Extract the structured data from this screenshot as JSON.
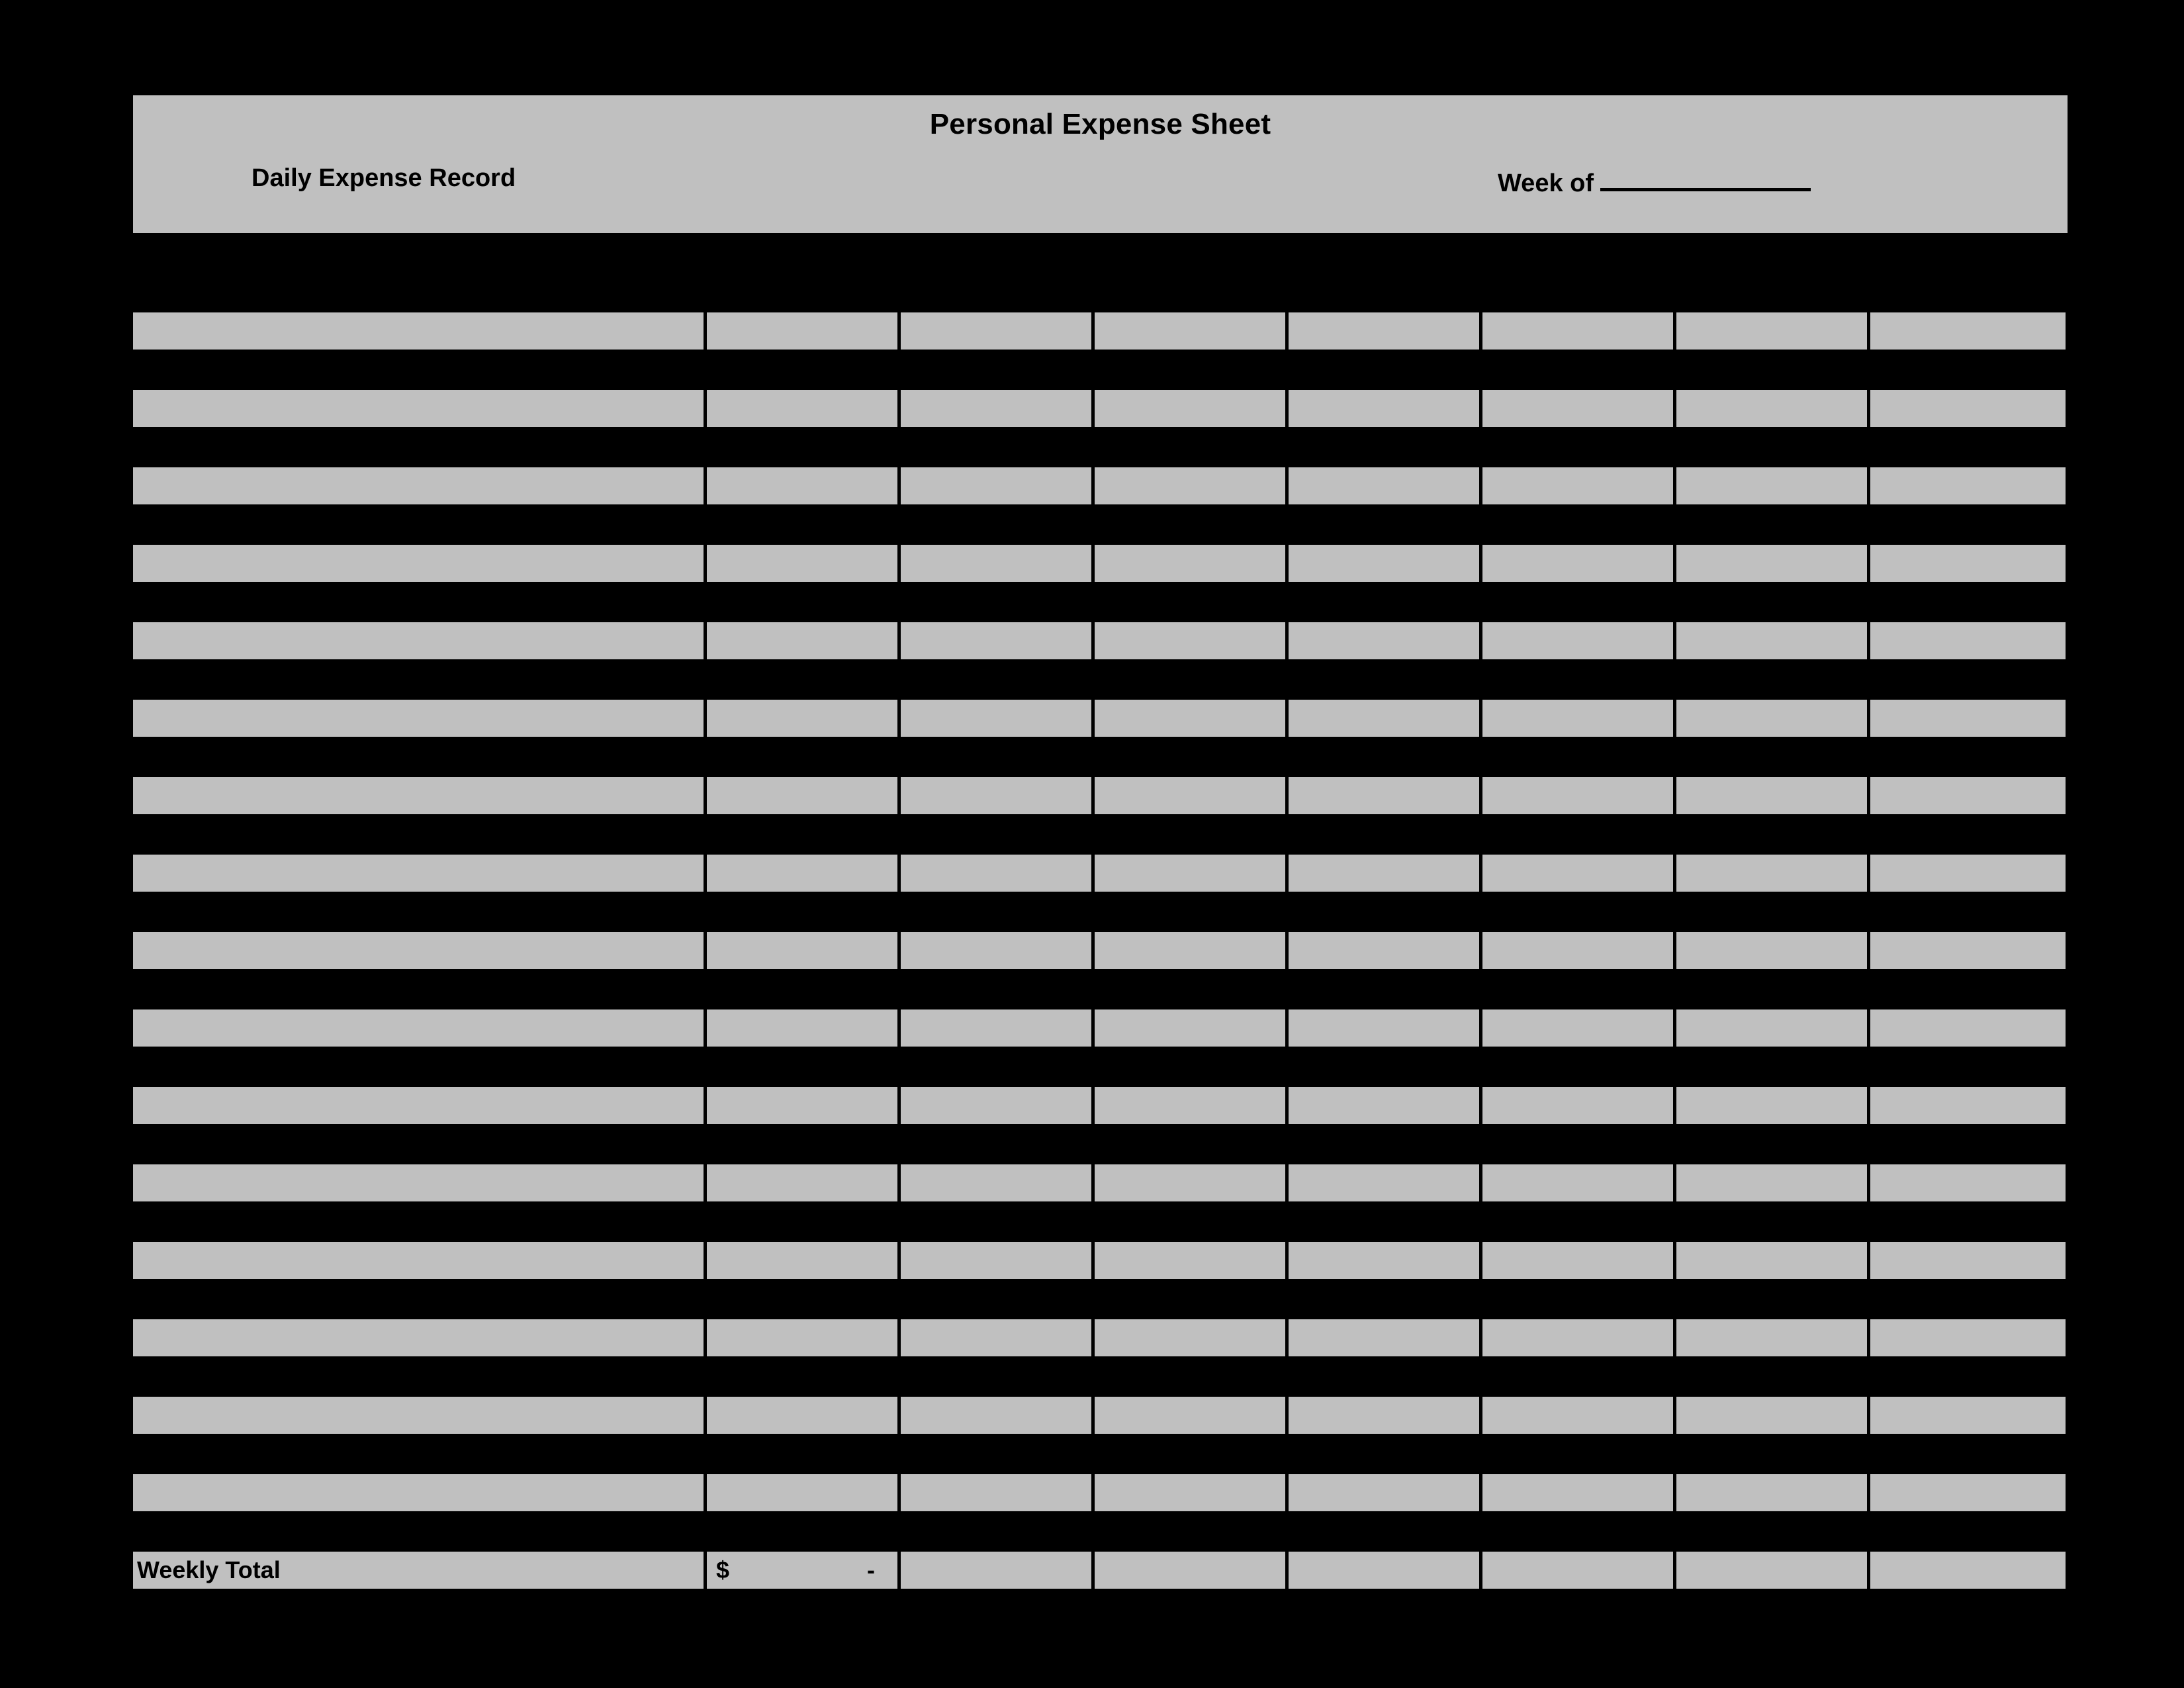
{
  "document": {
    "title": "Personal Expense Sheet",
    "subtitle": "Daily Expense Record",
    "week_of_label": "Week of",
    "week_of_value": "",
    "paper_color": "#c0c0c0",
    "ink_color": "#000000",
    "background_color": "#000000"
  },
  "table": {
    "column_count": 8,
    "entry_row_count": 16,
    "columns": [
      {
        "key": "description",
        "header": "",
        "width_kind": "wide"
      },
      {
        "key": "amount_1",
        "header": "",
        "width_kind": "narrow"
      },
      {
        "key": "amount_2",
        "header": "",
        "width_kind": "narrow"
      },
      {
        "key": "amount_3",
        "header": "",
        "width_kind": "narrow"
      },
      {
        "key": "amount_4",
        "header": "",
        "width_kind": "narrow"
      },
      {
        "key": "amount_5",
        "header": "",
        "width_kind": "narrow"
      },
      {
        "key": "amount_6",
        "header": "",
        "width_kind": "narrow"
      },
      {
        "key": "amount_7",
        "header": "",
        "width_kind": "narrow"
      }
    ],
    "rows": [
      {
        "description": "",
        "amount_1": "",
        "amount_2": "",
        "amount_3": "",
        "amount_4": "",
        "amount_5": "",
        "amount_6": "",
        "amount_7": ""
      },
      {
        "description": "",
        "amount_1": "",
        "amount_2": "",
        "amount_3": "",
        "amount_4": "",
        "amount_5": "",
        "amount_6": "",
        "amount_7": ""
      },
      {
        "description": "",
        "amount_1": "",
        "amount_2": "",
        "amount_3": "",
        "amount_4": "",
        "amount_5": "",
        "amount_6": "",
        "amount_7": ""
      },
      {
        "description": "",
        "amount_1": "",
        "amount_2": "",
        "amount_3": "",
        "amount_4": "",
        "amount_5": "",
        "amount_6": "",
        "amount_7": ""
      },
      {
        "description": "",
        "amount_1": "",
        "amount_2": "",
        "amount_3": "",
        "amount_4": "",
        "amount_5": "",
        "amount_6": "",
        "amount_7": ""
      },
      {
        "description": "",
        "amount_1": "",
        "amount_2": "",
        "amount_3": "",
        "amount_4": "",
        "amount_5": "",
        "amount_6": "",
        "amount_7": ""
      },
      {
        "description": "",
        "amount_1": "",
        "amount_2": "",
        "amount_3": "",
        "amount_4": "",
        "amount_5": "",
        "amount_6": "",
        "amount_7": ""
      },
      {
        "description": "",
        "amount_1": "",
        "amount_2": "",
        "amount_3": "",
        "amount_4": "",
        "amount_5": "",
        "amount_6": "",
        "amount_7": ""
      },
      {
        "description": "",
        "amount_1": "",
        "amount_2": "",
        "amount_3": "",
        "amount_4": "",
        "amount_5": "",
        "amount_6": "",
        "amount_7": ""
      },
      {
        "description": "",
        "amount_1": "",
        "amount_2": "",
        "amount_3": "",
        "amount_4": "",
        "amount_5": "",
        "amount_6": "",
        "amount_7": ""
      },
      {
        "description": "",
        "amount_1": "",
        "amount_2": "",
        "amount_3": "",
        "amount_4": "",
        "amount_5": "",
        "amount_6": "",
        "amount_7": ""
      },
      {
        "description": "",
        "amount_1": "",
        "amount_2": "",
        "amount_3": "",
        "amount_4": "",
        "amount_5": "",
        "amount_6": "",
        "amount_7": ""
      },
      {
        "description": "",
        "amount_1": "",
        "amount_2": "",
        "amount_3": "",
        "amount_4": "",
        "amount_5": "",
        "amount_6": "",
        "amount_7": ""
      },
      {
        "description": "",
        "amount_1": "",
        "amount_2": "",
        "amount_3": "",
        "amount_4": "",
        "amount_5": "",
        "amount_6": "",
        "amount_7": ""
      },
      {
        "description": "",
        "amount_1": "",
        "amount_2": "",
        "amount_3": "",
        "amount_4": "",
        "amount_5": "",
        "amount_6": "",
        "amount_7": ""
      },
      {
        "description": "",
        "amount_1": "",
        "amount_2": "",
        "amount_3": "",
        "amount_4": "",
        "amount_5": "",
        "amount_6": "",
        "amount_7": ""
      }
    ]
  },
  "totals": {
    "label": "Weekly Total",
    "currency_symbol": "$",
    "value": "-",
    "other_cells": [
      "",
      "",
      "",
      "",
      "",
      ""
    ]
  }
}
